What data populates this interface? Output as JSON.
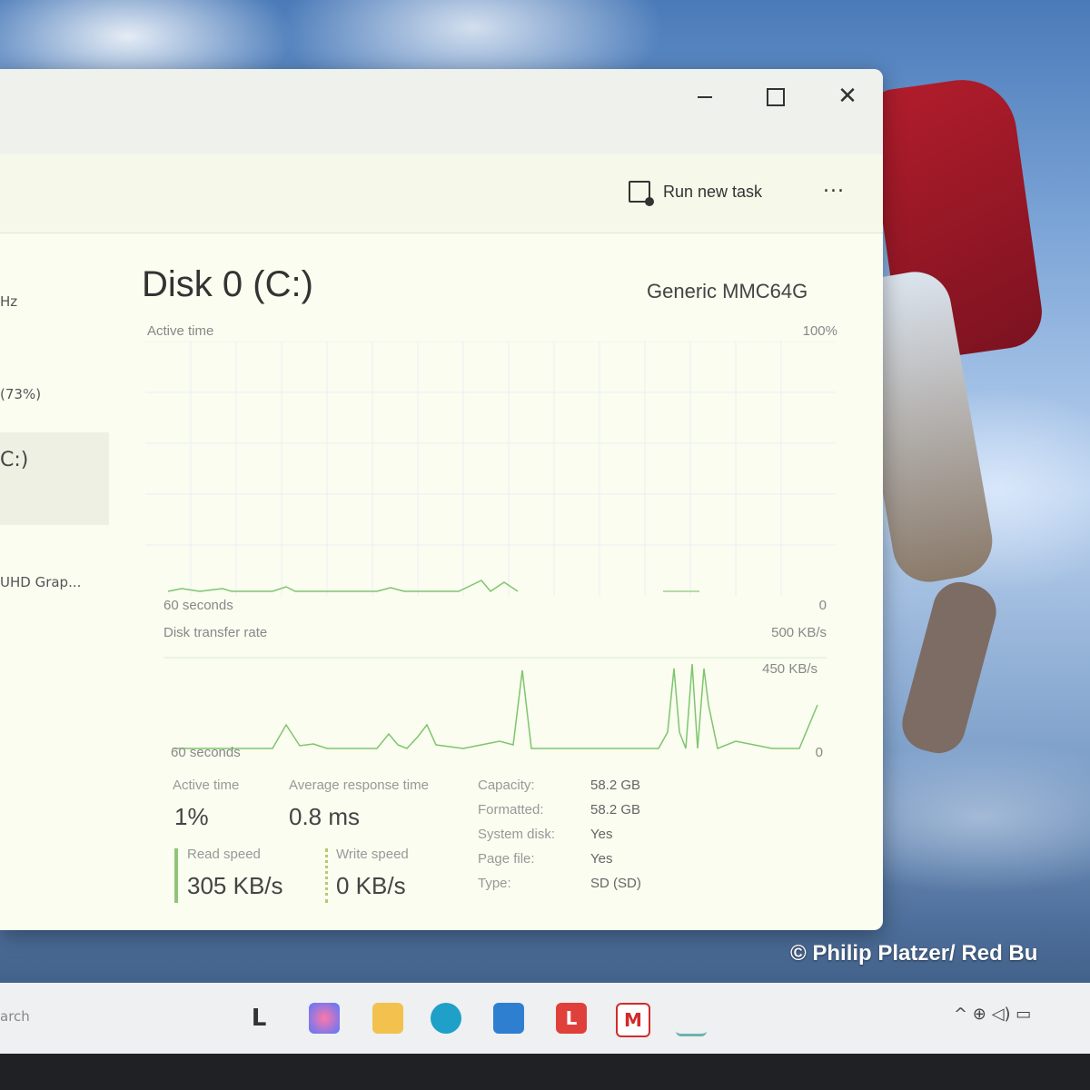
{
  "wallpaper": {
    "credit": "© Philip Platzer/ Red Bu"
  },
  "window": {
    "controls": {
      "minimize": "—",
      "maximize": "□",
      "close": "✕"
    },
    "toolbar": {
      "run_new_task": "Run new task",
      "more": "..."
    },
    "sidebar": {
      "items": [
        "Hz",
        "(73%)",
        "C:)",
        "UHD Grap..."
      ]
    },
    "disk": {
      "title": "Disk 0 (C:)",
      "model": "Generic MMC64G"
    },
    "active_time_graph": {
      "label": "Active time",
      "max": "100%",
      "time_label": "60 seconds",
      "min": "0"
    },
    "transfer_graph": {
      "label": "Disk transfer rate",
      "max": "500 KB/s",
      "secondary": "450 KB/s",
      "time_label": "60 seconds",
      "min": "0"
    },
    "stats": {
      "active_time_label": "Active time",
      "active_time_value": "1%",
      "avg_response_label": "Average response time",
      "avg_response_value": "0.8 ms",
      "read_speed_label": "Read speed",
      "read_speed_value": "305 KB/s",
      "write_speed_label": "Write speed",
      "write_speed_value": "0 KB/s"
    },
    "properties": [
      {
        "label": "Capacity:",
        "value": "58.2 GB"
      },
      {
        "label": "Formatted:",
        "value": "58.2 GB"
      },
      {
        "label": "System disk:",
        "value": "Yes"
      },
      {
        "label": "Page file:",
        "value": "Yes"
      },
      {
        "label": "Type:",
        "value": "SD (SD)"
      }
    ]
  },
  "taskbar": {
    "search": "arch",
    "icons": [
      "file-explorer-icon",
      "copilot-icon",
      "folder-icon",
      "edge-icon",
      "store-icon",
      "lens-app-icon",
      "mcafee-icon",
      "task-manager-icon"
    ],
    "tray": "^  ⊕ ◁) ▭"
  },
  "colors": {
    "window_bg": "#fafdf0",
    "graph_line": "#7fc56e",
    "read_bar": "#8fc57a",
    "write_bar": "#b8c96d"
  }
}
